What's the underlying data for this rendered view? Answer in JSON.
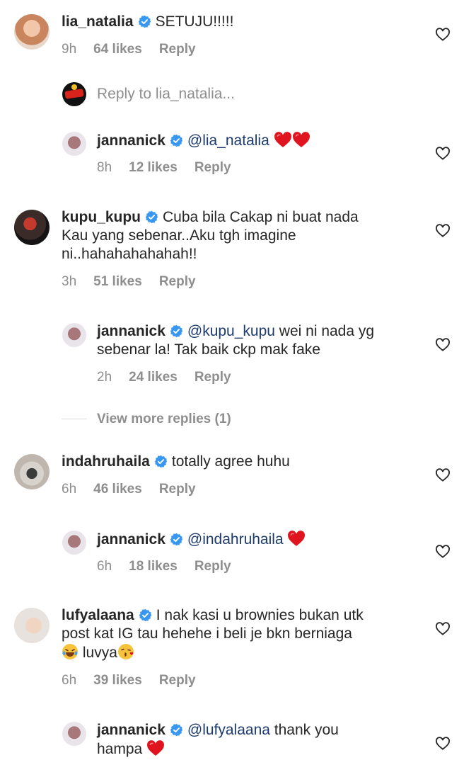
{
  "colors": {
    "mention": "#1d3b6e",
    "muted": "#8e8e8e",
    "text": "#262626",
    "verified": "#3897f0",
    "heart_red": "#e0141f"
  },
  "comments": [
    {
      "user": "lia_natalia",
      "text": "SETUJU!!!!!",
      "time": "9h",
      "likes": "64 likes",
      "reply": "Reply"
    },
    {
      "user": "jannanick",
      "mention": "@lia_natalia",
      "time": "8h",
      "likes": "12 likes",
      "reply": "Reply"
    },
    {
      "user": "kupu_kupu",
      "lines": [
        "Cuba bila Cakap ni buat nada",
        "Kau yang sebenar..Aku tgh imagine",
        "ni..hahahahahahah!!"
      ],
      "time": "3h",
      "likes": "51 likes",
      "reply": "Reply"
    },
    {
      "user": "jannanick",
      "mention": "@kupu_kupu",
      "line1": "wei ni nada yg",
      "line2": "sebenar la! Tak baik ckp mak fake",
      "time": "2h",
      "likes": "24 likes",
      "reply": "Reply"
    },
    {
      "user": "indahruhaila",
      "text": "totally agree huhu",
      "time": "6h",
      "likes": "46 likes",
      "reply": "Reply"
    },
    {
      "user": "jannanick",
      "mention": "@indahruhaila",
      "time": "6h",
      "likes": "18 likes",
      "reply": "Reply"
    },
    {
      "user": "lufyalaana",
      "line1": "I nak kasi u brownies bukan utk",
      "line2": "post kat IG tau hehehe i beli je bkn berniaga",
      "line3": "luvya",
      "time": "6h",
      "likes": "39 likes",
      "reply": "Reply"
    },
    {
      "user": "jannanick",
      "mention": "@lufyalaana",
      "line1": "thank you",
      "line2": "hampa"
    }
  ],
  "reply_placeholder": "Reply to lia_natalia...",
  "view_more": "View more replies (1)",
  "icons": [
    "heart-icon",
    "verified-badge-icon",
    "red-heart-emoji",
    "laughing-tears-emoji",
    "kiss-emoji"
  ]
}
